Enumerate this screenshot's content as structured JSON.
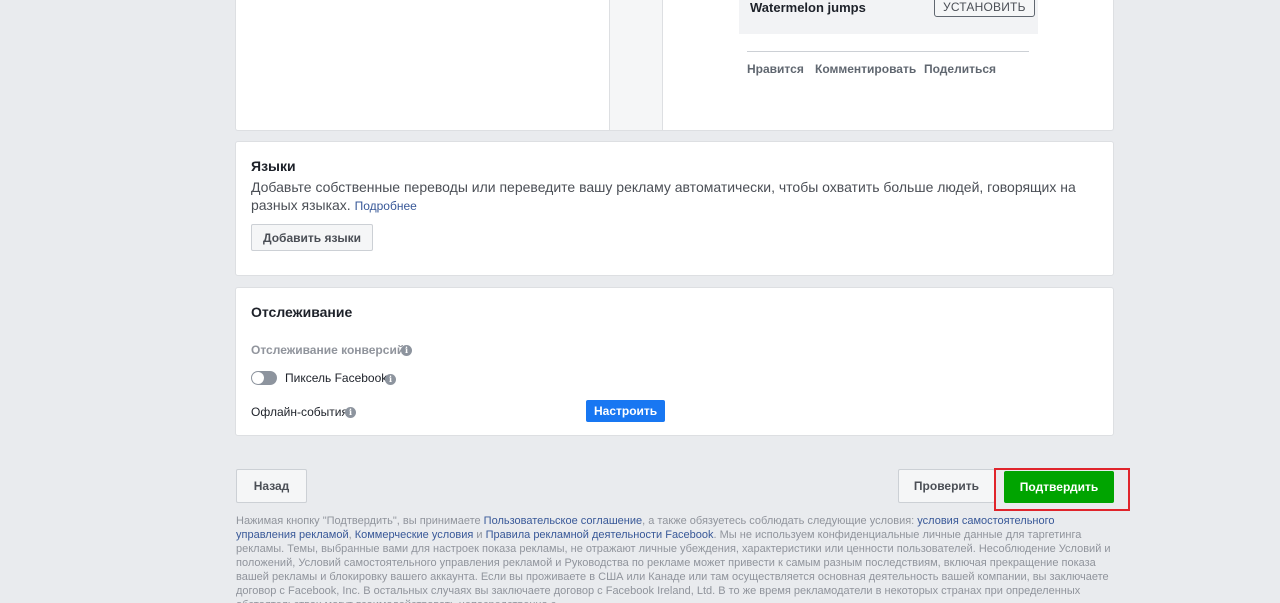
{
  "preview": {
    "ad_name": "Watermelon jumps",
    "install_label": "УСТАНОВИТЬ",
    "actions": [
      "Нравится",
      "Комментировать",
      "Поделиться"
    ]
  },
  "languages": {
    "title": "Языки",
    "description": "Добавьте собственные переводы или переведите вашу рекламу автоматически, чтобы охватить больше людей, говорящих на разных языках.",
    "more_link": "Подробнее",
    "add_button": "Добавить языки"
  },
  "tracking": {
    "title": "Отслеживание",
    "conversion_label": "Отслеживание конверсий",
    "pixel_label": "Пиксель Facebook",
    "pixel_enabled": false,
    "offline_label": "Офлайн-события",
    "setup_button": "Настроить"
  },
  "footer": {
    "back_button": "Назад",
    "check_button": "Проверить",
    "confirm_button": "Подтвердить"
  },
  "legal": {
    "part1": "Нажимая кнопку \"Подтвердить\", вы принимаете ",
    "link1": "Пользовательское соглашение",
    "part2": ", а также обязуетесь соблюдать следующие условия: ",
    "link2": "условия самостоятельного управления рекламой",
    "part3": ", ",
    "link3": "Коммерческие условия",
    "part4": " и ",
    "link4": "Правила рекламной деятельности Facebook",
    "part5": ". Мы не используем конфиденциальные личные данные для таргетинга рекламы. Темы, выбранные вами для настроек показа рекламы, не отражают личные убеждения, характеристики или ценности пользователей. Несоблюдение Условий и положений, Условий самостоятельного управления рекламой и Руководства по рекламе может привести к самым разным последствиям, включая прекращение показа вашей рекламы и блокировку вашего аккаунта. Если вы проживаете в США или Канаде или там осуществляется основная деятельность вашей компании, вы заключаете договор с Facebook, Inc. В остальных случаях вы заключаете договор с Facebook Ireland, Ltd. В то же время рекламодатели в некоторых странах при определенных обстоятельствах могут взаимодействовать непосредственно с"
  },
  "colors": {
    "accent_blue": "#1877f2",
    "confirm_green": "#00a400",
    "highlight_red": "#e0242b"
  }
}
